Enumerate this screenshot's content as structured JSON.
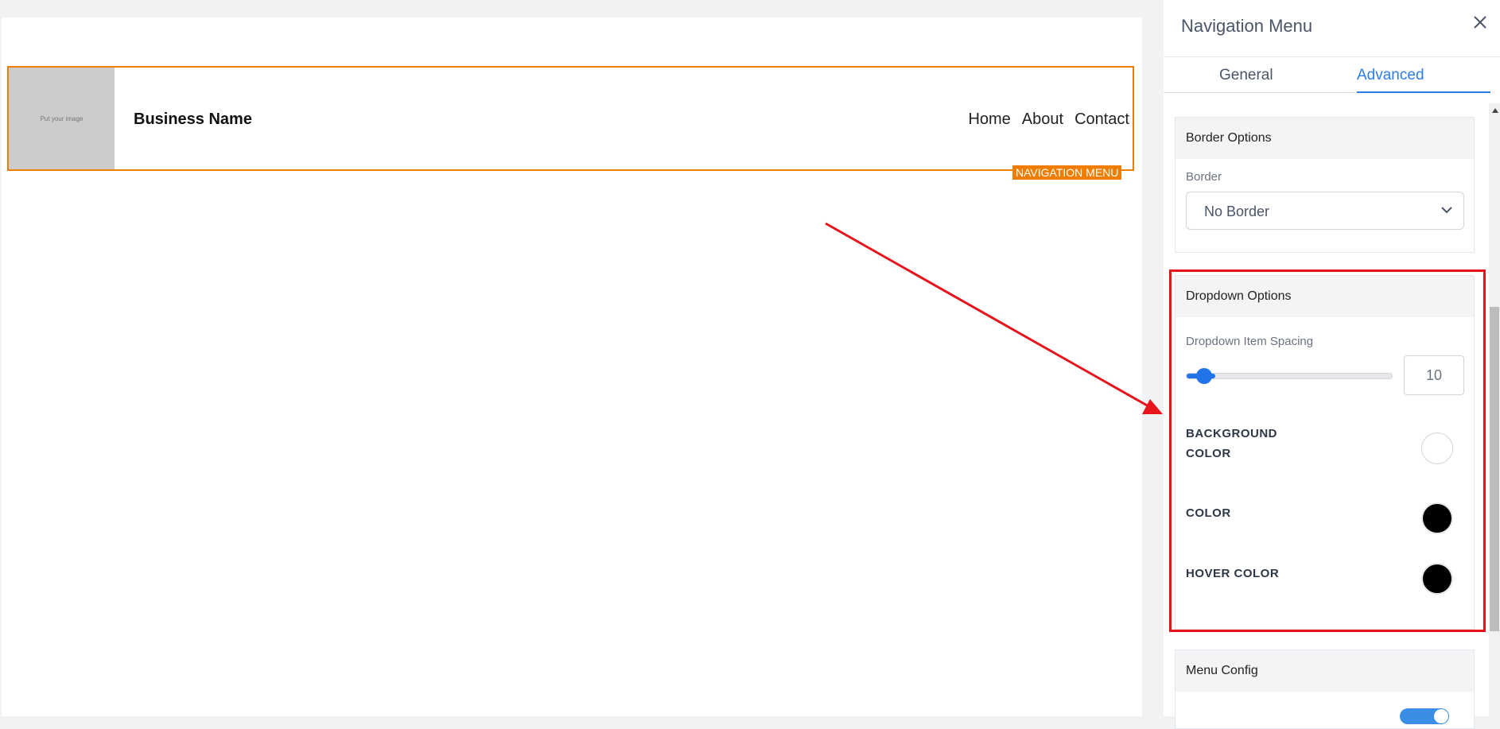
{
  "canvas": {
    "logo_placeholder": "Put your image",
    "business_name": "Business Name",
    "nav_links": [
      "Home",
      "About",
      "Contact"
    ],
    "element_tag": "NAVIGATION MENU"
  },
  "panel": {
    "title": "Navigation Menu",
    "tabs": [
      {
        "label": "General",
        "active": false
      },
      {
        "label": "Advanced",
        "active": true
      }
    ],
    "border_options": {
      "title": "Border Options",
      "border_label": "Border",
      "border_value": "No Border"
    },
    "dropdown_options": {
      "title": "Dropdown Options",
      "spacing_label": "Dropdown Item Spacing",
      "spacing_value": "10",
      "background_color_label": "BACKGROUND COLOR",
      "background_color": "#ffffff",
      "color_label": "COLOR",
      "color": "#000000",
      "hover_color_label": "HOVER COLOR",
      "hover_color": "#000000"
    },
    "menu_config": {
      "title": "Menu Config"
    }
  },
  "colors": {
    "accent": "#2b7de9",
    "selection_outline": "#f07c00",
    "annotation": "#e8141c"
  },
  "icons": [
    "close-icon",
    "chevron-down-icon"
  ]
}
